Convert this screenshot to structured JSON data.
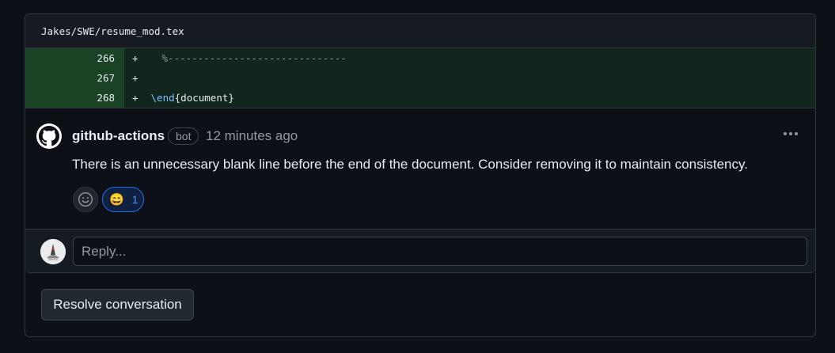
{
  "file": {
    "path": "Jakes/SWE/resume_mod.tex"
  },
  "diff": {
    "lines": [
      {
        "number": "266",
        "marker": "+",
        "content": "%------------------------------"
      },
      {
        "number": "267",
        "marker": "+",
        "content": ""
      },
      {
        "number": "268",
        "marker": "+",
        "keyword": "\\end",
        "rest": "{document}"
      }
    ]
  },
  "comment": {
    "author": "github-actions",
    "badge": "bot",
    "time": "12 minutes ago",
    "body": "There is an unnecessary blank line before the end of the document. Consider removing it to maintain consistency.",
    "reactions": [
      {
        "icon": "grinning-face-icon",
        "emoji": "😄",
        "count": "1"
      }
    ],
    "add_reaction_icon": "smiley-icon"
  },
  "reply": {
    "placeholder": "Reply..."
  },
  "actions": {
    "resolve_label": "Resolve conversation"
  },
  "colors": {
    "added_line_bg": "#12261e",
    "added_number_bg": "#1a4224",
    "accent": "#1f6feb"
  }
}
